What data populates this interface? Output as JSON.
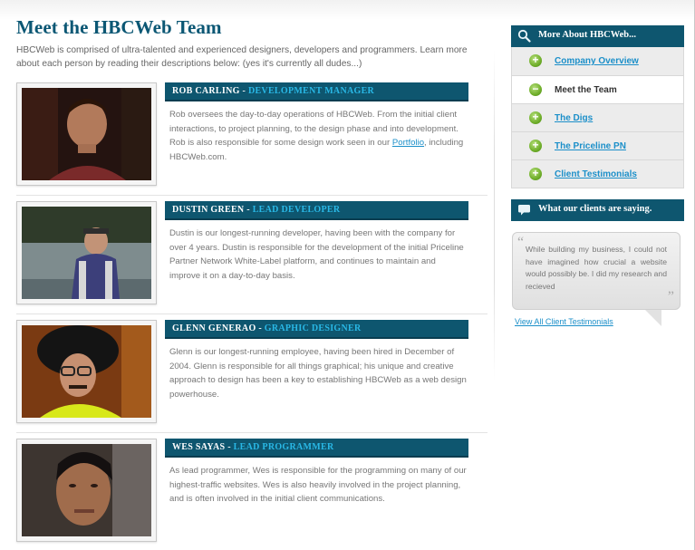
{
  "page": {
    "title": "Meet the HBCWeb Team",
    "intro": "HBCWeb is comprised of ultra-talented and experienced designers, developers and programmers. Learn more about each person by reading their descriptions below: (yes it's currently all dudes...)"
  },
  "members": [
    {
      "name": "Rob Carling",
      "separator": " - ",
      "role": "Development Manager",
      "bio_before": "Rob oversees the day-to-day operations of HBCWeb. From the initial client interactions, to project planning, to the design phase and into development. Rob is also responsible for some design work seen in our ",
      "bio_link": "Portfolio",
      "bio_after": ", including HBCWeb.com."
    },
    {
      "name": "Dustin Green",
      "separator": " - ",
      "role": "Lead Developer",
      "bio": "Dustin is our longest-running developer, having been with the company for over 4 years. Dustin is responsible for the development of the initial Priceline Partner Network White-Label platform, and continues to maintain and improve it on a day-to-day basis."
    },
    {
      "name": "Glenn Generao",
      "separator": " - ",
      "role": "Graphic Designer",
      "bio": "Glenn is our longest-running employee, having been hired in December of 2004. Glenn is responsible for all things graphical; his unique and creative approach to design has been a key to establishing HBCWeb as a web design powerhouse."
    },
    {
      "name": "Wes Sayas",
      "separator": " - ",
      "role": "Lead Programmer",
      "bio": "As lead programmer, Wes is responsible for the programming on many of our highest-traffic websites. Wes is also heavily involved in the project planning, and is often involved in the initial client communications."
    }
  ],
  "sidebar": {
    "more_about": {
      "title": "More About HBCWeb...",
      "icon": "magnifier-icon",
      "items": [
        {
          "label": "Company Overview",
          "icon": "plus-icon",
          "active": false
        },
        {
          "label": "Meet the Team",
          "icon": "minus-icon",
          "active": true
        },
        {
          "label": "The Digs",
          "icon": "plus-icon",
          "active": false
        },
        {
          "label": "The Priceline PN",
          "icon": "plus-icon",
          "active": false
        },
        {
          "label": "Client Testimonials",
          "icon": "plus-icon",
          "active": false
        }
      ]
    },
    "clients": {
      "title": "What our clients are saying.",
      "icon": "speech-bubble-icon",
      "quote": "While building my business, I could not have imagined how crucial a website would possibly be. I did my research and recieved",
      "view_all": "View All Client Testimonials"
    }
  },
  "colors": {
    "brand": "#0e566f",
    "role_accent": "#29b8e6",
    "link": "#1b8fc9",
    "icon_green": "#6fae2a"
  }
}
